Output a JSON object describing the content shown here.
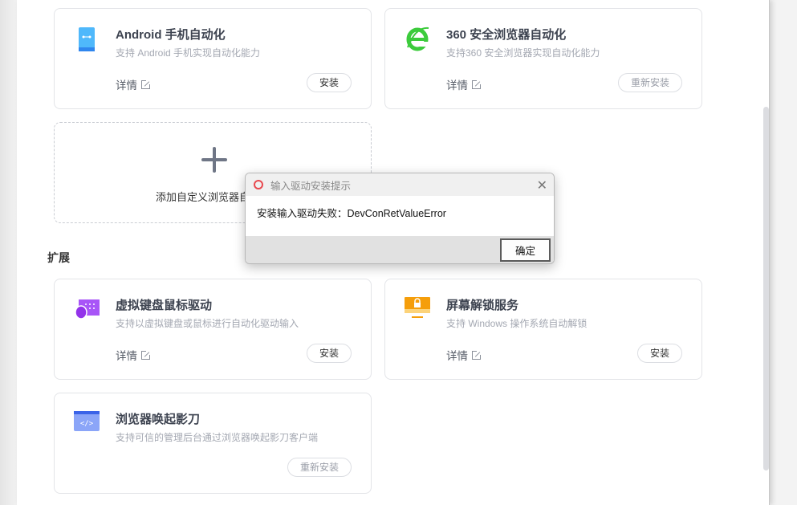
{
  "cards": [
    {
      "title": "Android 手机自动化",
      "desc": "支持 Android 手机实现自动化能力",
      "detail": "详情",
      "button": "安装",
      "icon": "android-phone-icon"
    },
    {
      "title": "360 安全浏览器自动化",
      "desc": "支持360 安全浏览器实现自动化能力",
      "detail": "详情",
      "button": "重新安装",
      "icon": "360-browser-icon"
    },
    {
      "title": "虚拟键盘鼠标驱动",
      "desc": "支持以虚拟键盘或鼠标进行自动化驱动输入",
      "detail": "详情",
      "button": "安装",
      "icon": "keyboard-mouse-icon"
    },
    {
      "title": "屏幕解锁服务",
      "desc": "支持 Windows 操作系统自动解锁",
      "detail": "详情",
      "button": "安装",
      "icon": "screen-lock-icon"
    },
    {
      "title": "浏览器唤起影刀",
      "desc": "支持可信的管理后台通过浏览器唤起影刀客户端",
      "button": "重新安装",
      "icon": "browser-code-icon"
    }
  ],
  "add_card": {
    "label": "添加自定义浏览器自动化"
  },
  "section_extension": "扩展",
  "dialog": {
    "title": "输入驱动安装提示",
    "message": "安装输入驱动失败：DevConRetValueError",
    "ok": "确定"
  }
}
